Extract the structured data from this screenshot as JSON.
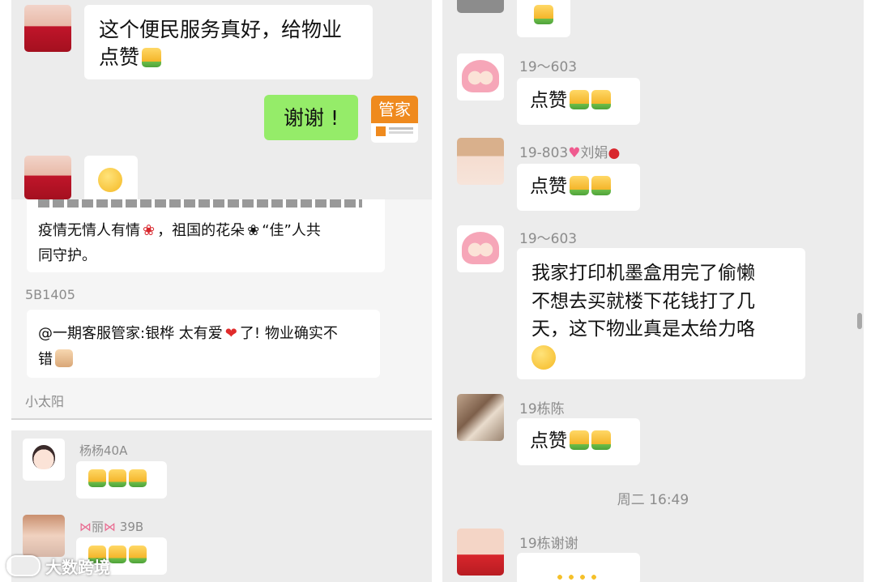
{
  "left_top": {
    "msg1": "这个便民服务真好，给物业点赞",
    "msg1_line1": "这个便民服务真好，给物业",
    "msg1_line2": "点赞",
    "reply": "谢谢 !",
    "manager_label": "管家"
  },
  "left_middle": {
    "msg_line1": "疫情无情人有情",
    "msg_line1b": "，祖国的花朵",
    "msg_line1c": "“佳”人共",
    "msg_line2": "同守护。",
    "name_5b1405": "5B1405",
    "mention_line1a": "@一期客服管家:银桦 太有爱",
    "mention_line1b": "了! 物业确实不",
    "mention_line2": "错",
    "name_xiaotaiyang": "小太阳"
  },
  "left_bottom": {
    "name1": "杨杨40A",
    "name2": "丽",
    "name2_suffix": " 39B"
  },
  "right": {
    "name_19_603": "19～603",
    "like_text": "点赞",
    "name_19_803": "19-803",
    "name_19_803_suffix": "刘娟",
    "long_msg_l1": "我家打印机墨盒用完了偷懒",
    "long_msg_l2": "不想去买就楼下花钱打了几",
    "long_msg_l3": "天，这下物业真是太给力咯",
    "name_19_chen": "19栋陈",
    "timestamp": "周二 16:49",
    "name_19_xie": "19栋谢谢"
  },
  "watermark": "大数跨境",
  "colors": {
    "chat_bg": "#ececec",
    "bubble": "#ffffff",
    "my_bubble": "#95ec69",
    "name": "#8c8c8c",
    "manager_orange": "#ef8a1e"
  }
}
